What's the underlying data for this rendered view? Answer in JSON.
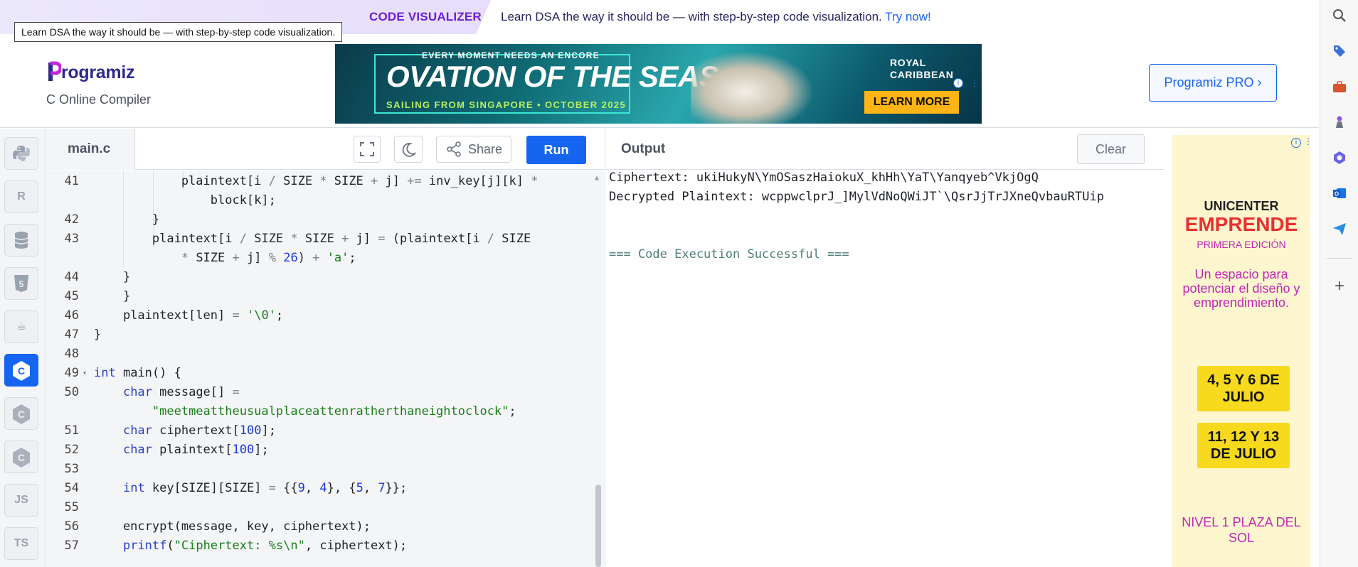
{
  "promo": {
    "brand": "CODE VISUALIZER",
    "text": "Learn DSA the way it should be — with step-by-step code visualization.",
    "link": "Try now!",
    "tooltip": "Learn DSA the way it should be — with step-by-step code visualization."
  },
  "header": {
    "logo_text": "rogramiz",
    "subtitle": "C Online Compiler",
    "pro_button": "Programiz PRO ›"
  },
  "ad_banner": {
    "small": "EVERY MOMENT NEEDS AN ENCORE",
    "headline": "OVATION OF THE SEAS",
    "tagline": "SAILING FROM SINGAPORE • OCTOBER 2025",
    "brand_line1": "ROYAL",
    "brand_line2": "CARIBBEAN",
    "cta": "LEARN MORE"
  },
  "rail": {
    "items": [
      {
        "name": "python",
        "glyph": "🐍"
      },
      {
        "name": "r",
        "glyph": "R"
      },
      {
        "name": "sql",
        "glyph": "≣"
      },
      {
        "name": "html",
        "glyph": "5"
      },
      {
        "name": "java",
        "glyph": "☕"
      },
      {
        "name": "c",
        "glyph": "C",
        "active": true
      },
      {
        "name": "cpp",
        "glyph": "C"
      },
      {
        "name": "csharp",
        "glyph": "C"
      },
      {
        "name": "js",
        "glyph": "JS"
      },
      {
        "name": "ts",
        "glyph": "TS"
      }
    ]
  },
  "editor": {
    "file_tab": "main.c",
    "share_label": "Share",
    "run_label": "Run"
  },
  "output": {
    "title": "Output",
    "clear_label": "Clear",
    "lines": {
      "cipher": "Ciphertext: ukiHukyN\\YmOSaszHaiokuX_khHh\\YaT\\Yanqyeb^VkjOgQ",
      "plain": "Decrypted Plaintext: wcppwclprJ_]MylVdNoQWiJT`\\QsrJjTrJXneQvbauRTUip",
      "success": "=== Code Execution Successful ==="
    }
  },
  "side_ad": {
    "line1": "UNICENTER",
    "line2": "EMPRENDE",
    "line3": "PRIMERA EDICIÓN",
    "line4": "Un espacio para potenciar el diseño y emprendimiento.",
    "date1": "4, 5 Y 6 DE JULIO",
    "date2": "11, 12 Y 13 DE JULIO",
    "venue": "NIVEL 1 PLAZA DEL SOL"
  },
  "colors": {
    "accent": "#1565f0",
    "brand_purple": "#6b1fd1",
    "editor_bg": "#f4f5f7"
  }
}
